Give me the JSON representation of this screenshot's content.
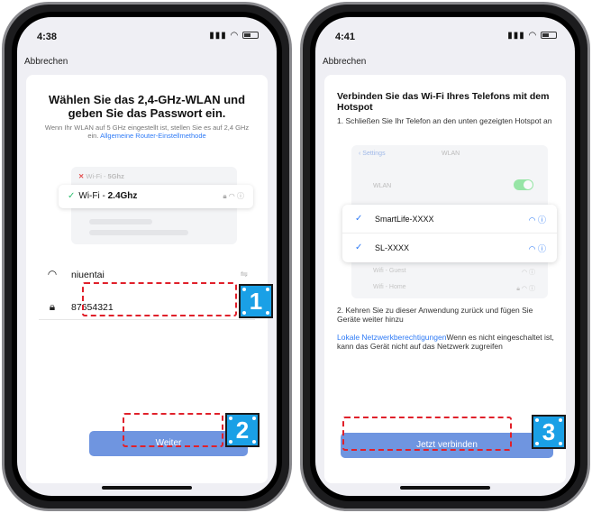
{
  "phone1": {
    "time": "4:38",
    "cancel": "Abbrechen",
    "title": "Wählen Sie das 2,4-GHz-WLAN und geben Sie das Passwort ein.",
    "desc": "Wenn Ihr WLAN auf 5 GHz eingestellt ist, stellen Sie es auf 2,4 GHz ein.",
    "desc_link": "Allgemeine Router-Einstellmethode",
    "wifi_5g_label": "Wi-Fi - ",
    "wifi_5g_band": "5Ghz",
    "wifi_24_label": "Wi-Fi - ",
    "wifi_24_band": "2.4Ghz",
    "ssid": "niuentai",
    "password": "87654321",
    "next_button": "Weiter"
  },
  "phone2": {
    "time": "4:41",
    "cancel": "Abbrechen",
    "title": "Verbinden Sie das Wi-Fi Ihres Telefons mit dem Hotspot",
    "step1": "1. Schließen Sie Ihr Telefon an den unten gezeigten Hotspot an",
    "settings_back": "Settings",
    "settings_title": "WLAN",
    "wlan_label": "WLAN",
    "hotspot1": "SmartLife-XXXX",
    "hotspot2": "SL-XXXX",
    "guest": "Wifi - Guest",
    "home": "Wifi - Home",
    "step2": "2. Kehren Sie zu dieser Anwendung zurück und fügen Sie Geräte weiter hinzu",
    "perm_link": "Lokale Netzwerkberechtigungen",
    "perm_text": "Wenn es nicht eingeschaltet ist, kann das Gerät nicht auf das Netzwerk zugreifen",
    "connect_button": "Jetzt verbinden"
  },
  "annotations": {
    "badge1": "1",
    "badge2": "2",
    "badge3": "3",
    "highlight_color": "#e0202a",
    "badge_color": "#1aa0e6"
  },
  "colors": {
    "accent": "#2f7bf6",
    "button": "#6f95e0"
  }
}
